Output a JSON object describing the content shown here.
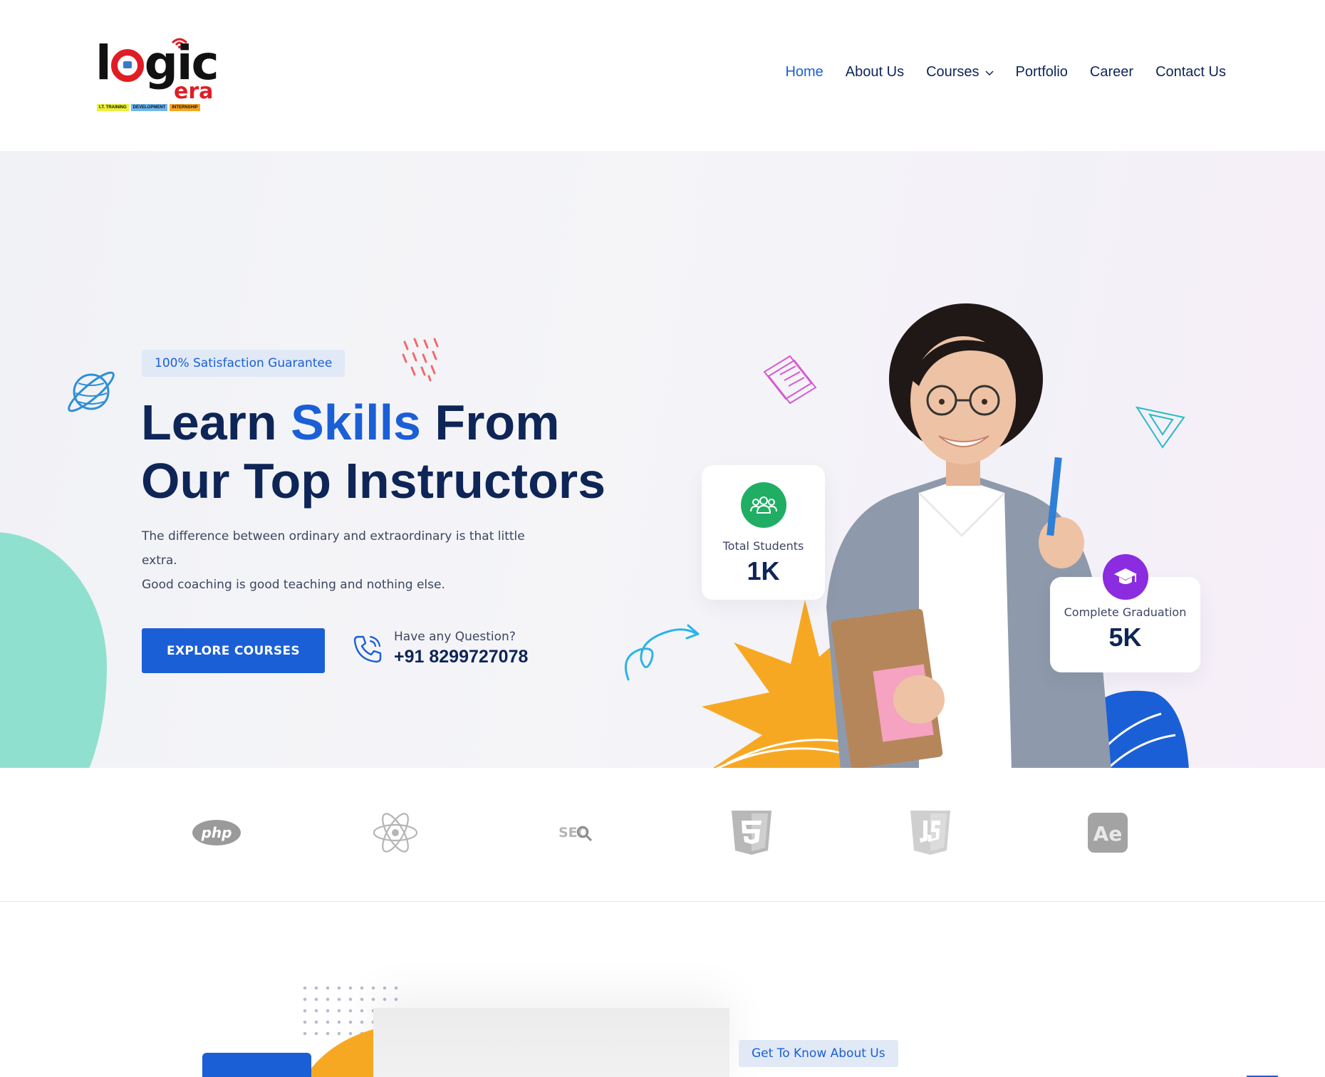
{
  "header": {
    "logo": {
      "wordmark": "logic",
      "subword": "era",
      "taglines": [
        "I.T. TRAINING",
        "DEVELOPMENT",
        "INTERNSHIP"
      ]
    },
    "nav": [
      {
        "label": "Home",
        "active": true
      },
      {
        "label": "About Us"
      },
      {
        "label": "Courses",
        "has_dropdown": true
      },
      {
        "label": "Portfolio"
      },
      {
        "label": "Career"
      },
      {
        "label": "Contact Us"
      }
    ]
  },
  "hero": {
    "badge": "100% Satisfaction Guarantee",
    "headline_part1": "Learn ",
    "headline_accent": "Skills",
    "headline_part2": " From",
    "headline_line2": "Our Top Instructors",
    "description_line1": "The difference between ordinary and extraordinary is that little extra.",
    "description_line2": "Good coaching is good teaching and nothing else.",
    "cta": "EXPLORE COURSES",
    "question_label": "Have any Question?",
    "phone": "+91 8299727078",
    "stats": [
      {
        "label": "Total Students",
        "value": "1K",
        "icon": "users-icon",
        "color": "#1fae63"
      },
      {
        "label": "Complete Graduation",
        "value": "5K",
        "icon": "graduation-cap-icon",
        "color": "#8b2ce0"
      }
    ]
  },
  "brands": [
    "php-logo",
    "react-logo",
    "seo-logo",
    "css3-logo",
    "javascript-logo",
    "after-effects-logo"
  ],
  "brand_texts": {
    "php": "php",
    "seo": "SEO",
    "ae": "Ae"
  },
  "about": {
    "badge": "Get To Know About Us"
  },
  "colors": {
    "primary": "#1a5fd6",
    "navy": "#0e2557",
    "mint": "#8fe0cf",
    "orange": "#f7a823"
  }
}
